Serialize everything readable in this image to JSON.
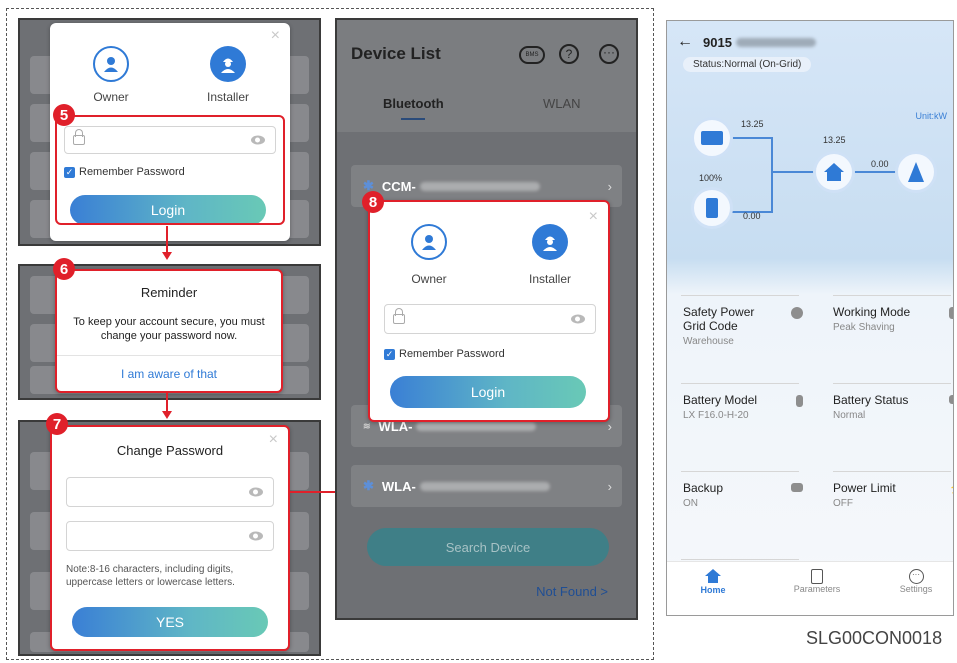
{
  "login_dialog": {
    "owner_label": "Owner",
    "installer_label": "Installer",
    "remember_label": "Remember Password",
    "login_label": "Login",
    "close": "×"
  },
  "steps": {
    "s5": "5",
    "s6": "6",
    "s7": "7",
    "s8": "8"
  },
  "reminder": {
    "title": "Reminder",
    "message": "To keep your account secure, you must change your password  now.",
    "action": "I am aware of that"
  },
  "change_password": {
    "title": "Change Password",
    "note": "Note:8-16 characters, including digits, uppercase letters or lowercase letters.",
    "confirm": "YES",
    "close": "×"
  },
  "device_list": {
    "title": "Device List",
    "tabs": [
      {
        "label": "Bluetooth"
      },
      {
        "label": "WLAN"
      }
    ],
    "rows": [
      {
        "prefix": "CCM-"
      },
      {
        "prefix": "WLA-"
      },
      {
        "prefix": "WLA-"
      }
    ],
    "search_button": "Search Device",
    "not_found": "Not Found >",
    "bms_icon_text": "BMS"
  },
  "overview": {
    "serial": "9015",
    "status": "Status:Normal (On-Grid)",
    "unit": "Unit:kW",
    "flow": {
      "pv_power": "13.25",
      "house_power": "13.25",
      "grid_power": "0.00",
      "battery_soc": "100%",
      "battery_power": "0.00"
    },
    "cells": [
      {
        "title": "Safety Power Grid Code",
        "value": "Warehouse"
      },
      {
        "title": "Working Mode",
        "value": "Peak Shaving"
      },
      {
        "title": "Battery Model",
        "value": "LX F16.0-H-20"
      },
      {
        "title": "Battery Status",
        "value": "Normal"
      },
      {
        "title": "Backup",
        "value": "ON"
      },
      {
        "title": "Power Limit",
        "value": "OFF"
      }
    ],
    "nav": [
      {
        "label": "Home"
      },
      {
        "label": "Parameters"
      },
      {
        "label": "Settings"
      }
    ]
  },
  "figure_code": "SLG00CON0018",
  "colors": {
    "accent": "#2f7ad6",
    "highlight": "#e0202a"
  }
}
